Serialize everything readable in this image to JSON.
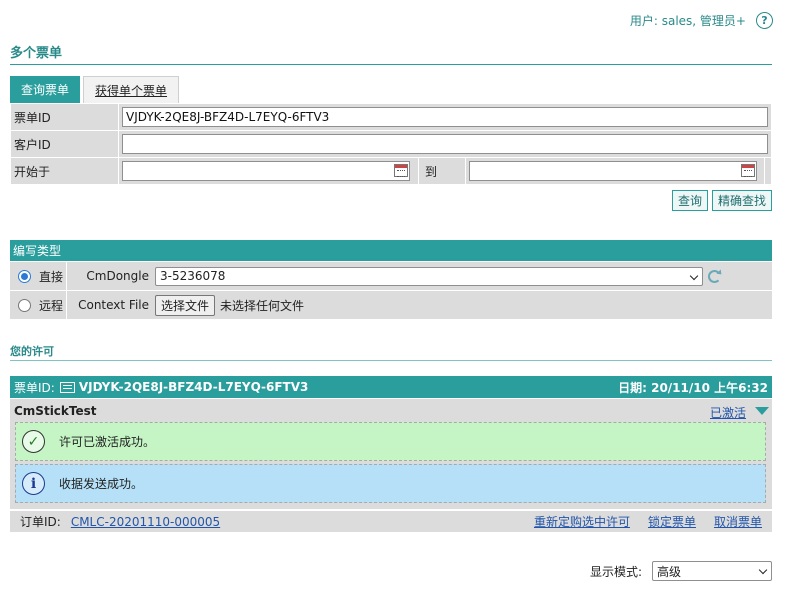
{
  "header": {
    "user_text": "用户: sales, 管理员+",
    "help_icon": "question-circle-icon"
  },
  "page": {
    "title": "多个票单"
  },
  "tabs": [
    {
      "label": "查询票单",
      "active": true
    },
    {
      "label": "获得单个票单",
      "active": false
    }
  ],
  "query": {
    "ticket_id_label": "票单ID",
    "ticket_id_value": "VJDYK-2QE8J-BFZ4D-L7EYQ-6FTV3",
    "customer_id_label": "客户ID",
    "customer_id_value": "",
    "start_label": "开始于",
    "start_value": "",
    "to_label": "到",
    "to_value": "",
    "search_button": "查询",
    "exact_search_button": "精确查找"
  },
  "write_type": {
    "title": "编写类型",
    "direct_label": "直接",
    "direct_selected": true,
    "cmdongle_label": "CmDongle",
    "cmdongle_value": "3-5236078",
    "remote_label": "远程",
    "remote_selected": false,
    "context_file_label": "Context File",
    "choose_file_button": "选择文件",
    "no_file_text": "未选择任何文件"
  },
  "licenses": {
    "title": "您的许可",
    "ticket_label": "票单ID:",
    "ticket_value": "VJDYK-2QE8J-BFZ4D-L7EYQ-6FTV3",
    "date_text": "日期: 20/11/10 上午6:32",
    "product_name": "CmStickTest",
    "status_link": "已激活",
    "success_message": "许可已激活成功。",
    "info_message": "收据发送成功。",
    "order_label": "订单ID:",
    "order_value": "CMLC-20201110-000005",
    "actions": [
      "重新定购选中许可",
      "锁定票单",
      "取消票单"
    ]
  },
  "display_mode": {
    "label": "显示模式:",
    "value": "高级"
  },
  "colors": {
    "accent": "#2a9d9d",
    "panel": "#dcdcdc",
    "success_bg": "#c5f5c5",
    "info_bg": "#b5e0f7",
    "link": "#2255aa"
  }
}
